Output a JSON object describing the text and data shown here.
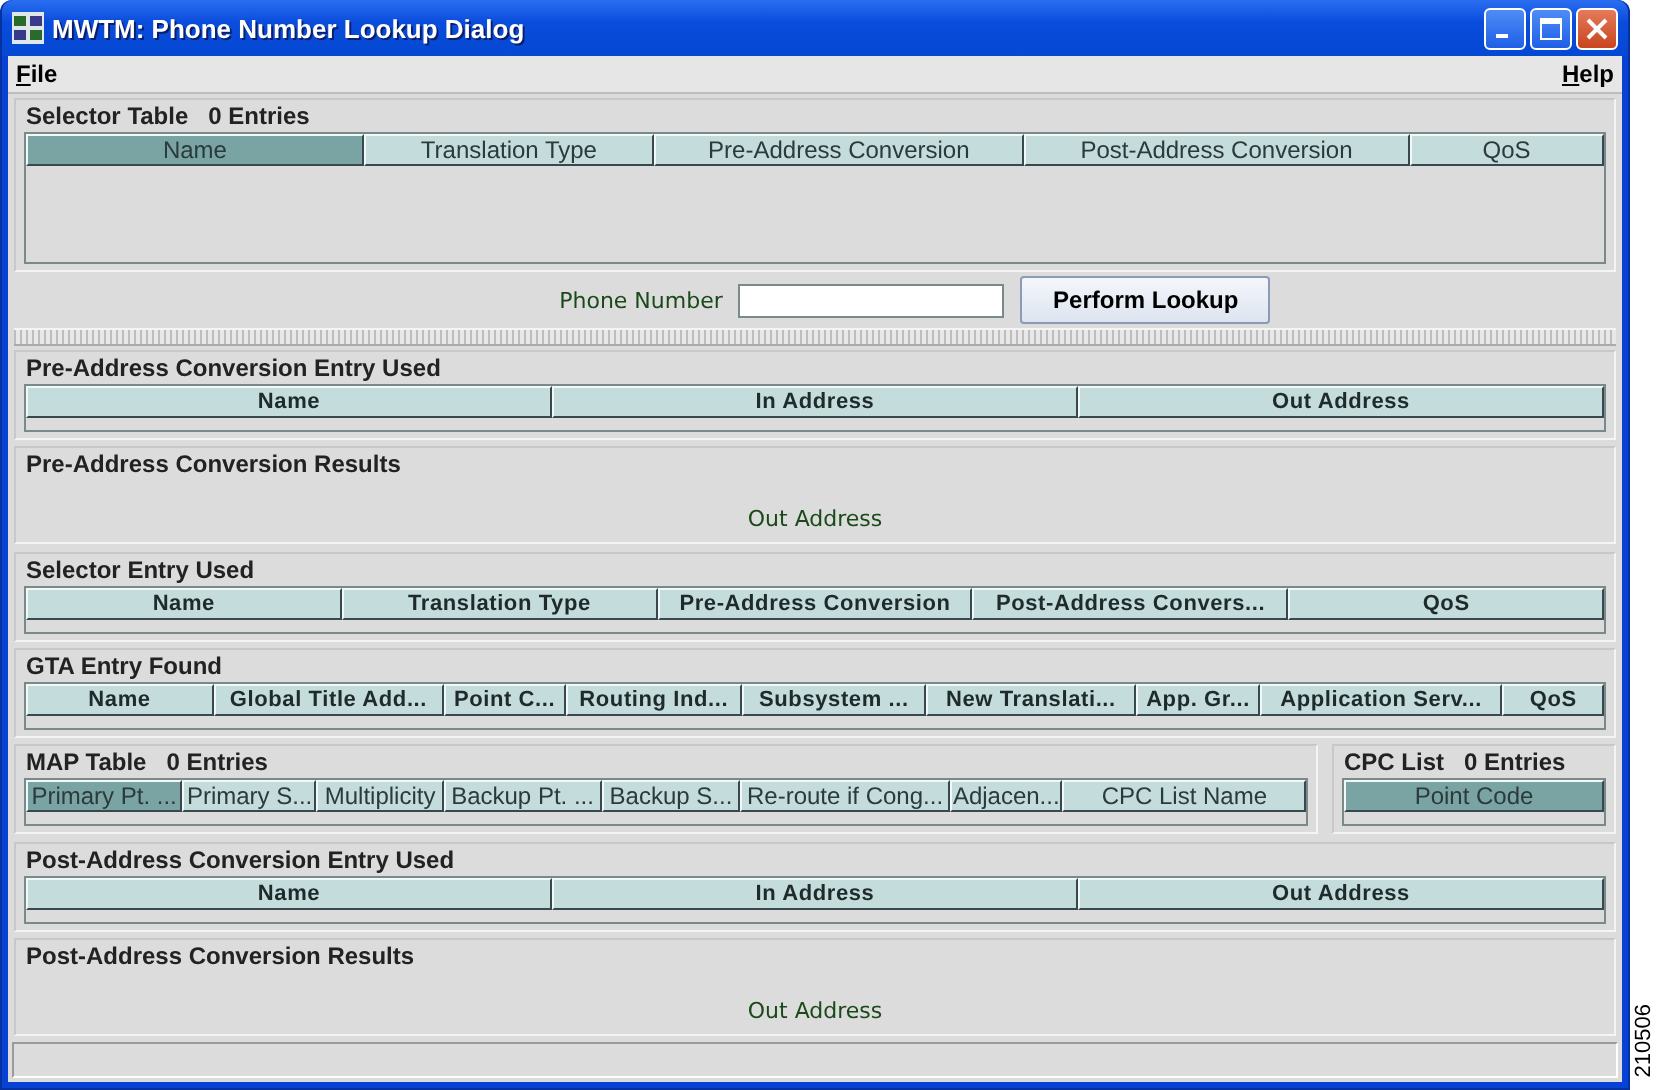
{
  "window": {
    "title": "MWTM: Phone Number Lookup Dialog"
  },
  "menu": [
    {
      "label": "File"
    },
    {
      "label": "Help"
    }
  ],
  "selector_table": {
    "title": "Selector Table",
    "count": "0 Entries",
    "columns": [
      {
        "label": "Name",
        "sorted": true
      },
      {
        "label": "Translation Type",
        "sorted": false
      },
      {
        "label": "Pre-Address Conversion",
        "sorted": false
      },
      {
        "label": "Post-Address Conversion",
        "sorted": false
      },
      {
        "label": "QoS",
        "sorted": false
      }
    ]
  },
  "lookup": {
    "label": "Phone Number",
    "button": "Perform Lookup"
  },
  "sections": [
    {
      "kind": "table",
      "title": "Pre-Address Conversion Entry Used",
      "columns": [
        {
          "label": "Name",
          "sorted": false
        },
        {
          "label": "In Address",
          "sorted": false
        },
        {
          "label": "Out Address",
          "sorted": false
        }
      ]
    },
    {
      "kind": "result",
      "title": "Pre-Address Conversion Results",
      "value": "Out Address"
    },
    {
      "kind": "table",
      "title": "Selector Entry Used",
      "columns": [
        {
          "label": "Name",
          "sorted": false
        },
        {
          "label": "Translation Type",
          "sorted": false
        },
        {
          "label": "Pre-Address Conversion",
          "sorted": false
        },
        {
          "label": "Post-Address Convers...",
          "sorted": false
        },
        {
          "label": "QoS",
          "sorted": false
        }
      ]
    },
    {
      "kind": "table",
      "title": "GTA Entry Found",
      "columns": [
        {
          "label": "Name",
          "sorted": false
        },
        {
          "label": "Global Title Add...",
          "sorted": false
        },
        {
          "label": "Point C...",
          "sorted": false
        },
        {
          "label": "Routing Ind...",
          "sorted": false
        },
        {
          "label": "Subsystem ...",
          "sorted": false
        },
        {
          "label": "New Translati...",
          "sorted": false
        },
        {
          "label": "App. Gr...",
          "sorted": false
        },
        {
          "label": "Application Serv...",
          "sorted": false
        },
        {
          "label": "QoS",
          "sorted": false
        }
      ]
    },
    {
      "kind": "pair",
      "panels": [
        {
          "title": "MAP Table",
          "count": "0 Entries",
          "columns": [
            {
              "label": "Primary Pt. ...",
              "sorted": true
            },
            {
              "label": "Primary S...",
              "sorted": false
            },
            {
              "label": "Multiplicity",
              "sorted": false
            },
            {
              "label": "Backup Pt. ...",
              "sorted": false
            },
            {
              "label": "Backup S...",
              "sorted": false
            },
            {
              "label": "Re-route if Cong...",
              "sorted": false
            },
            {
              "label": "Adjacen...",
              "sorted": false
            },
            {
              "label": "CPC List Name",
              "sorted": false
            }
          ]
        },
        {
          "title": "CPC List",
          "count": "0 Entries",
          "columns": [
            {
              "label": "Point Code",
              "sorted": true
            }
          ]
        }
      ]
    },
    {
      "kind": "table",
      "title": "Post-Address Conversion Entry Used",
      "columns": [
        {
          "label": "Name",
          "sorted": false
        },
        {
          "label": "In Address",
          "sorted": false
        },
        {
          "label": "Out Address",
          "sorted": false
        }
      ]
    },
    {
      "kind": "result",
      "title": "Post-Address Conversion Results",
      "value": "Out Address"
    }
  ],
  "figure_id": "210506"
}
